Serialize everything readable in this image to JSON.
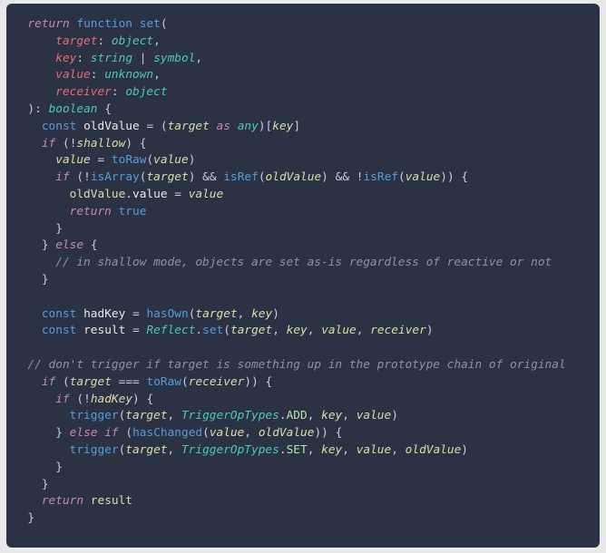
{
  "code": {
    "lines": [
      [
        {
          "s": "  ",
          "c": ""
        },
        {
          "s": "return",
          "c": "tk-kw"
        },
        {
          "s": " "
        },
        {
          "s": "function",
          "c": "tk-fn"
        },
        {
          "s": " "
        },
        {
          "s": "set",
          "c": "tk-callb"
        },
        {
          "s": "(",
          "c": "tk-punc"
        }
      ],
      [
        {
          "s": "      "
        },
        {
          "s": "target",
          "c": "tk-red"
        },
        {
          "s": ":",
          "c": "tk-punc"
        },
        {
          "s": " "
        },
        {
          "s": "object",
          "c": "tk-ty"
        },
        {
          "s": ",",
          "c": "tk-punc"
        }
      ],
      [
        {
          "s": "      "
        },
        {
          "s": "key",
          "c": "tk-red"
        },
        {
          "s": ":",
          "c": "tk-punc"
        },
        {
          "s": " "
        },
        {
          "s": "string",
          "c": "tk-ty"
        },
        {
          "s": " "
        },
        {
          "s": "|",
          "c": "tk-op"
        },
        {
          "s": " "
        },
        {
          "s": "symbol",
          "c": "tk-ty"
        },
        {
          "s": ",",
          "c": "tk-punc"
        }
      ],
      [
        {
          "s": "      "
        },
        {
          "s": "value",
          "c": "tk-red"
        },
        {
          "s": ":",
          "c": "tk-punc"
        },
        {
          "s": " "
        },
        {
          "s": "unknown",
          "c": "tk-ty"
        },
        {
          "s": ",",
          "c": "tk-punc"
        }
      ],
      [
        {
          "s": "      "
        },
        {
          "s": "receiver",
          "c": "tk-red"
        },
        {
          "s": ":",
          "c": "tk-punc"
        },
        {
          "s": " "
        },
        {
          "s": "object",
          "c": "tk-ty"
        }
      ],
      [
        {
          "s": "  "
        },
        {
          "s": ")",
          "c": "tk-punc"
        },
        {
          "s": ":",
          "c": "tk-punc"
        },
        {
          "s": " "
        },
        {
          "s": "boolean",
          "c": "tk-ty"
        },
        {
          "s": " "
        },
        {
          "s": "{",
          "c": "tk-punc"
        }
      ],
      [
        {
          "s": "    "
        },
        {
          "s": "const",
          "c": "tk-fn"
        },
        {
          "s": " "
        },
        {
          "s": "oldValue",
          "c": "tk-var"
        },
        {
          "s": " "
        },
        {
          "s": "=",
          "c": "tk-op"
        },
        {
          "s": " "
        },
        {
          "s": "(",
          "c": "tk-punc"
        },
        {
          "s": "target",
          "c": "tk-id"
        },
        {
          "s": " "
        },
        {
          "s": "as",
          "c": "tk-kw"
        },
        {
          "s": " "
        },
        {
          "s": "any",
          "c": "tk-ty"
        },
        {
          "s": ")[",
          "c": "tk-punc"
        },
        {
          "s": "key",
          "c": "tk-id"
        },
        {
          "s": "]",
          "c": "tk-punc"
        }
      ],
      [
        {
          "s": "    "
        },
        {
          "s": "if",
          "c": "tk-kw"
        },
        {
          "s": " "
        },
        {
          "s": "(",
          "c": "tk-punc"
        },
        {
          "s": "!",
          "c": "tk-op"
        },
        {
          "s": "shallow",
          "c": "tk-id"
        },
        {
          "s": ")",
          "c": "tk-punc"
        },
        {
          "s": " "
        },
        {
          "s": "{",
          "c": "tk-punc"
        }
      ],
      [
        {
          "s": "      "
        },
        {
          "s": "value",
          "c": "tk-id"
        },
        {
          "s": " "
        },
        {
          "s": "=",
          "c": "tk-op"
        },
        {
          "s": " "
        },
        {
          "s": "toRaw",
          "c": "tk-callb"
        },
        {
          "s": "(",
          "c": "tk-punc"
        },
        {
          "s": "value",
          "c": "tk-id"
        },
        {
          "s": ")",
          "c": "tk-punc"
        }
      ],
      [
        {
          "s": "      "
        },
        {
          "s": "if",
          "c": "tk-kw"
        },
        {
          "s": " "
        },
        {
          "s": "(",
          "c": "tk-punc"
        },
        {
          "s": "!",
          "c": "tk-op"
        },
        {
          "s": "isArray",
          "c": "tk-callb"
        },
        {
          "s": "(",
          "c": "tk-punc"
        },
        {
          "s": "target",
          "c": "tk-id"
        },
        {
          "s": ")",
          "c": "tk-punc"
        },
        {
          "s": " "
        },
        {
          "s": "&&",
          "c": "tk-op"
        },
        {
          "s": " "
        },
        {
          "s": "isRef",
          "c": "tk-callb"
        },
        {
          "s": "(",
          "c": "tk-punc"
        },
        {
          "s": "oldValue",
          "c": "tk-id"
        },
        {
          "s": ")",
          "c": "tk-punc"
        },
        {
          "s": " "
        },
        {
          "s": "&&",
          "c": "tk-op"
        },
        {
          "s": " "
        },
        {
          "s": "!",
          "c": "tk-op"
        },
        {
          "s": "isRef",
          "c": "tk-callb"
        },
        {
          "s": "(",
          "c": "tk-punc"
        },
        {
          "s": "value",
          "c": "tk-id"
        },
        {
          "s": "))",
          "c": "tk-punc"
        },
        {
          "s": " "
        },
        {
          "s": "{",
          "c": "tk-punc"
        }
      ],
      [
        {
          "s": "        "
        },
        {
          "s": "oldValue",
          "c": "tk-idn"
        },
        {
          "s": ".",
          "c": "tk-punc"
        },
        {
          "s": "value",
          "c": "tk-var"
        },
        {
          "s": " "
        },
        {
          "s": "=",
          "c": "tk-op"
        },
        {
          "s": " "
        },
        {
          "s": "value",
          "c": "tk-id"
        }
      ],
      [
        {
          "s": "        "
        },
        {
          "s": "return",
          "c": "tk-kw"
        },
        {
          "s": " "
        },
        {
          "s": "true",
          "c": "tk-bool"
        }
      ],
      [
        {
          "s": "      "
        },
        {
          "s": "}",
          "c": "tk-punc"
        }
      ],
      [
        {
          "s": "    "
        },
        {
          "s": "}",
          "c": "tk-punc"
        },
        {
          "s": " "
        },
        {
          "s": "else",
          "c": "tk-kw"
        },
        {
          "s": " "
        },
        {
          "s": "{",
          "c": "tk-punc"
        }
      ],
      [
        {
          "s": "      "
        },
        {
          "s": "// in shallow mode, objects are set as-is regardless of reactive or not",
          "c": "tk-cm"
        }
      ],
      [
        {
          "s": "    "
        },
        {
          "s": "}",
          "c": "tk-punc"
        }
      ],
      [
        {
          "s": ""
        }
      ],
      [
        {
          "s": "    "
        },
        {
          "s": "const",
          "c": "tk-fn"
        },
        {
          "s": " "
        },
        {
          "s": "hadKey",
          "c": "tk-var"
        },
        {
          "s": " "
        },
        {
          "s": "=",
          "c": "tk-op"
        },
        {
          "s": " "
        },
        {
          "s": "hasOwn",
          "c": "tk-callb"
        },
        {
          "s": "(",
          "c": "tk-punc"
        },
        {
          "s": "target",
          "c": "tk-id"
        },
        {
          "s": ",",
          "c": "tk-punc"
        },
        {
          "s": " "
        },
        {
          "s": "key",
          "c": "tk-id"
        },
        {
          "s": ")",
          "c": "tk-punc"
        }
      ],
      [
        {
          "s": "    "
        },
        {
          "s": "const",
          "c": "tk-fn"
        },
        {
          "s": " "
        },
        {
          "s": "result",
          "c": "tk-var"
        },
        {
          "s": " "
        },
        {
          "s": "=",
          "c": "tk-op"
        },
        {
          "s": " "
        },
        {
          "s": "Reflect",
          "c": "tk-ty"
        },
        {
          "s": ".",
          "c": "tk-punc"
        },
        {
          "s": "set",
          "c": "tk-callb"
        },
        {
          "s": "(",
          "c": "tk-punc"
        },
        {
          "s": "target",
          "c": "tk-id"
        },
        {
          "s": ",",
          "c": "tk-punc"
        },
        {
          "s": " "
        },
        {
          "s": "key",
          "c": "tk-id"
        },
        {
          "s": ",",
          "c": "tk-punc"
        },
        {
          "s": " "
        },
        {
          "s": "value",
          "c": "tk-id"
        },
        {
          "s": ",",
          "c": "tk-punc"
        },
        {
          "s": " "
        },
        {
          "s": "receiver",
          "c": "tk-id"
        },
        {
          "s": ")",
          "c": "tk-punc"
        }
      ],
      [
        {
          "s": ""
        }
      ],
      [
        {
          "s": "  "
        },
        {
          "s": "// don't trigger if target is something up in the prototype chain of original",
          "c": "tk-cm"
        }
      ],
      [
        {
          "s": "    "
        },
        {
          "s": "if",
          "c": "tk-kw"
        },
        {
          "s": " "
        },
        {
          "s": "(",
          "c": "tk-punc"
        },
        {
          "s": "target",
          "c": "tk-id"
        },
        {
          "s": " "
        },
        {
          "s": "===",
          "c": "tk-op"
        },
        {
          "s": " "
        },
        {
          "s": "toRaw",
          "c": "tk-callb"
        },
        {
          "s": "(",
          "c": "tk-punc"
        },
        {
          "s": "receiver",
          "c": "tk-id"
        },
        {
          "s": "))",
          "c": "tk-punc"
        },
        {
          "s": " "
        },
        {
          "s": "{",
          "c": "tk-punc"
        }
      ],
      [
        {
          "s": "      "
        },
        {
          "s": "if",
          "c": "tk-kw"
        },
        {
          "s": " "
        },
        {
          "s": "(",
          "c": "tk-punc"
        },
        {
          "s": "!",
          "c": "tk-op"
        },
        {
          "s": "hadKey",
          "c": "tk-id"
        },
        {
          "s": ")",
          "c": "tk-punc"
        },
        {
          "s": " "
        },
        {
          "s": "{",
          "c": "tk-punc"
        }
      ],
      [
        {
          "s": "        "
        },
        {
          "s": "trigger",
          "c": "tk-callb"
        },
        {
          "s": "(",
          "c": "tk-punc"
        },
        {
          "s": "target",
          "c": "tk-id"
        },
        {
          "s": ",",
          "c": "tk-punc"
        },
        {
          "s": " "
        },
        {
          "s": "TriggerOpTypes",
          "c": "tk-ty"
        },
        {
          "s": ".",
          "c": "tk-punc"
        },
        {
          "s": "ADD",
          "c": "tk-enum"
        },
        {
          "s": ",",
          "c": "tk-punc"
        },
        {
          "s": " "
        },
        {
          "s": "key",
          "c": "tk-id"
        },
        {
          "s": ",",
          "c": "tk-punc"
        },
        {
          "s": " "
        },
        {
          "s": "value",
          "c": "tk-id"
        },
        {
          "s": ")",
          "c": "tk-punc"
        }
      ],
      [
        {
          "s": "      "
        },
        {
          "s": "}",
          "c": "tk-punc"
        },
        {
          "s": " "
        },
        {
          "s": "else",
          "c": "tk-kw"
        },
        {
          "s": " "
        },
        {
          "s": "if",
          "c": "tk-kw"
        },
        {
          "s": " "
        },
        {
          "s": "(",
          "c": "tk-punc"
        },
        {
          "s": "hasChanged",
          "c": "tk-callb"
        },
        {
          "s": "(",
          "c": "tk-punc"
        },
        {
          "s": "value",
          "c": "tk-id"
        },
        {
          "s": ",",
          "c": "tk-punc"
        },
        {
          "s": " "
        },
        {
          "s": "oldValue",
          "c": "tk-id"
        },
        {
          "s": "))",
          "c": "tk-punc"
        },
        {
          "s": " "
        },
        {
          "s": "{",
          "c": "tk-punc"
        }
      ],
      [
        {
          "s": "        "
        },
        {
          "s": "trigger",
          "c": "tk-callb"
        },
        {
          "s": "(",
          "c": "tk-punc"
        },
        {
          "s": "target",
          "c": "tk-id"
        },
        {
          "s": ",",
          "c": "tk-punc"
        },
        {
          "s": " "
        },
        {
          "s": "TriggerOpTypes",
          "c": "tk-ty"
        },
        {
          "s": ".",
          "c": "tk-punc"
        },
        {
          "s": "SET",
          "c": "tk-enum"
        },
        {
          "s": ",",
          "c": "tk-punc"
        },
        {
          "s": " "
        },
        {
          "s": "key",
          "c": "tk-id"
        },
        {
          "s": ",",
          "c": "tk-punc"
        },
        {
          "s": " "
        },
        {
          "s": "value",
          "c": "tk-id"
        },
        {
          "s": ",",
          "c": "tk-punc"
        },
        {
          "s": " "
        },
        {
          "s": "oldValue",
          "c": "tk-id"
        },
        {
          "s": ")",
          "c": "tk-punc"
        }
      ],
      [
        {
          "s": "      "
        },
        {
          "s": "}",
          "c": "tk-punc"
        }
      ],
      [
        {
          "s": "    "
        },
        {
          "s": "}",
          "c": "tk-punc"
        }
      ],
      [
        {
          "s": "    "
        },
        {
          "s": "return",
          "c": "tk-kw"
        },
        {
          "s": " "
        },
        {
          "s": "result",
          "c": "tk-idn"
        }
      ],
      [
        {
          "s": "  "
        },
        {
          "s": "}",
          "c": "tk-punc"
        }
      ]
    ]
  }
}
